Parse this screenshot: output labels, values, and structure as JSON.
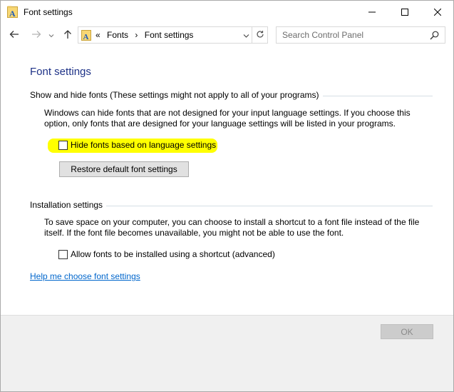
{
  "window": {
    "title": "Font settings",
    "icon": "font-folder-icon"
  },
  "address": {
    "overflow": "«",
    "crumbs": [
      "Fonts",
      "Font settings"
    ],
    "separator": "›"
  },
  "search": {
    "placeholder": "Search Control Panel"
  },
  "page": {
    "title": "Font settings"
  },
  "show_hide": {
    "header": "Show and hide fonts (These settings might not apply to all of your programs)",
    "description": "Windows can hide fonts that are not designed for your input language settings. If you choose this option, only fonts that are designed for your language settings will be listed in your programs.",
    "checkbox_label": "Hide fonts based on language settings",
    "checked": false,
    "highlight_color": "#ffff00",
    "restore_button": "Restore default font settings"
  },
  "installation": {
    "header": "Installation settings",
    "description": "To save space on your computer, you can choose to install a shortcut to a font file instead of the file itself. If the font file becomes unavailable, you might not be able to use the font.",
    "checkbox_label": "Allow fonts to be installed using a shortcut (advanced)",
    "checked": false
  },
  "help_link": "Help me choose font settings",
  "footer": {
    "ok_label": "OK",
    "ok_enabled": false
  },
  "colors": {
    "title_blue": "#1e3287",
    "link_blue": "#0066cc",
    "footer_bg": "#f0f0f0"
  }
}
